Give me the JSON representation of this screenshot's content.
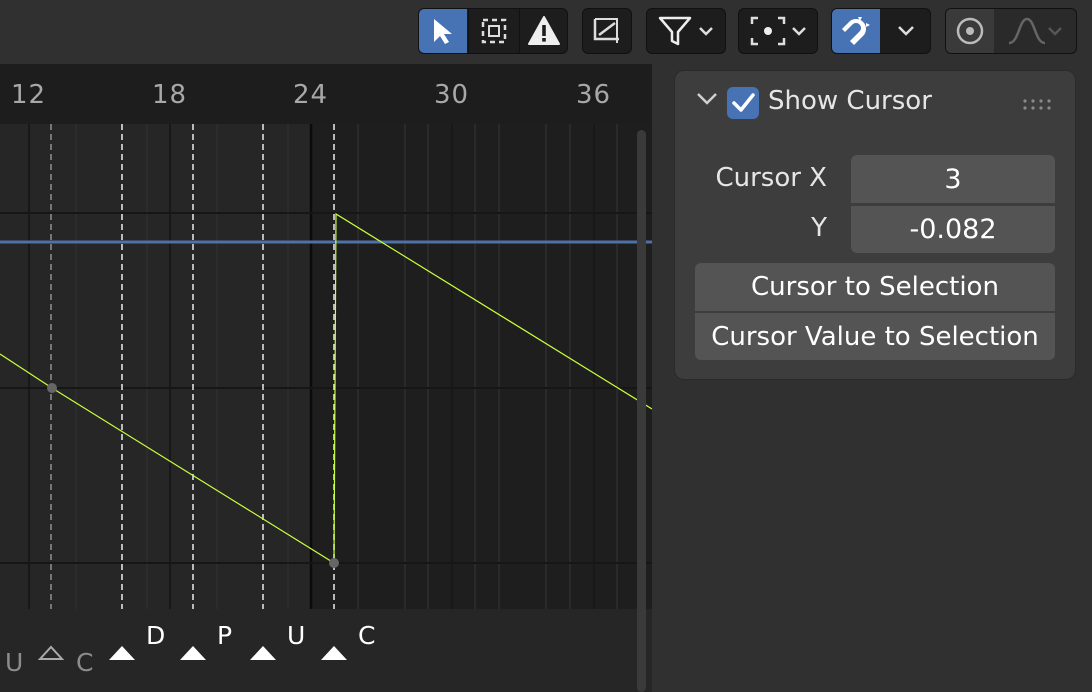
{
  "toolbar": {
    "icons": [
      "select-arrow-icon",
      "box-select-icon",
      "warning-icon",
      "normalize-icon",
      "filter-icon",
      "pivot-point-icon",
      "snap-magnet-icon",
      "proportional-edit-icon",
      "falloff-curve-icon"
    ]
  },
  "graph": {
    "frame_labels": [
      "12",
      "18",
      "24",
      "30",
      "36"
    ],
    "markers": [
      {
        "label": "U",
        "selected": false
      },
      {
        "label": "C",
        "selected": false
      },
      {
        "label": "D",
        "selected": true
      },
      {
        "label": "P",
        "selected": true
      },
      {
        "label": "U",
        "selected": true
      },
      {
        "label": "C",
        "selected": true
      }
    ]
  },
  "panel": {
    "header_label": "Show Cursor",
    "show_cursor_checked": true,
    "cursor_x_label": "Cursor X",
    "cursor_x_value": "3",
    "y_label": "Y",
    "y_value": "-0.082",
    "cursor_to_selection": "Cursor to Selection",
    "cursor_value_to_selection": "Cursor Value to Selection"
  },
  "colors": {
    "accent": "#4772b3",
    "curve": "#c8ff3c",
    "cursor_line": "#5070a8"
  }
}
